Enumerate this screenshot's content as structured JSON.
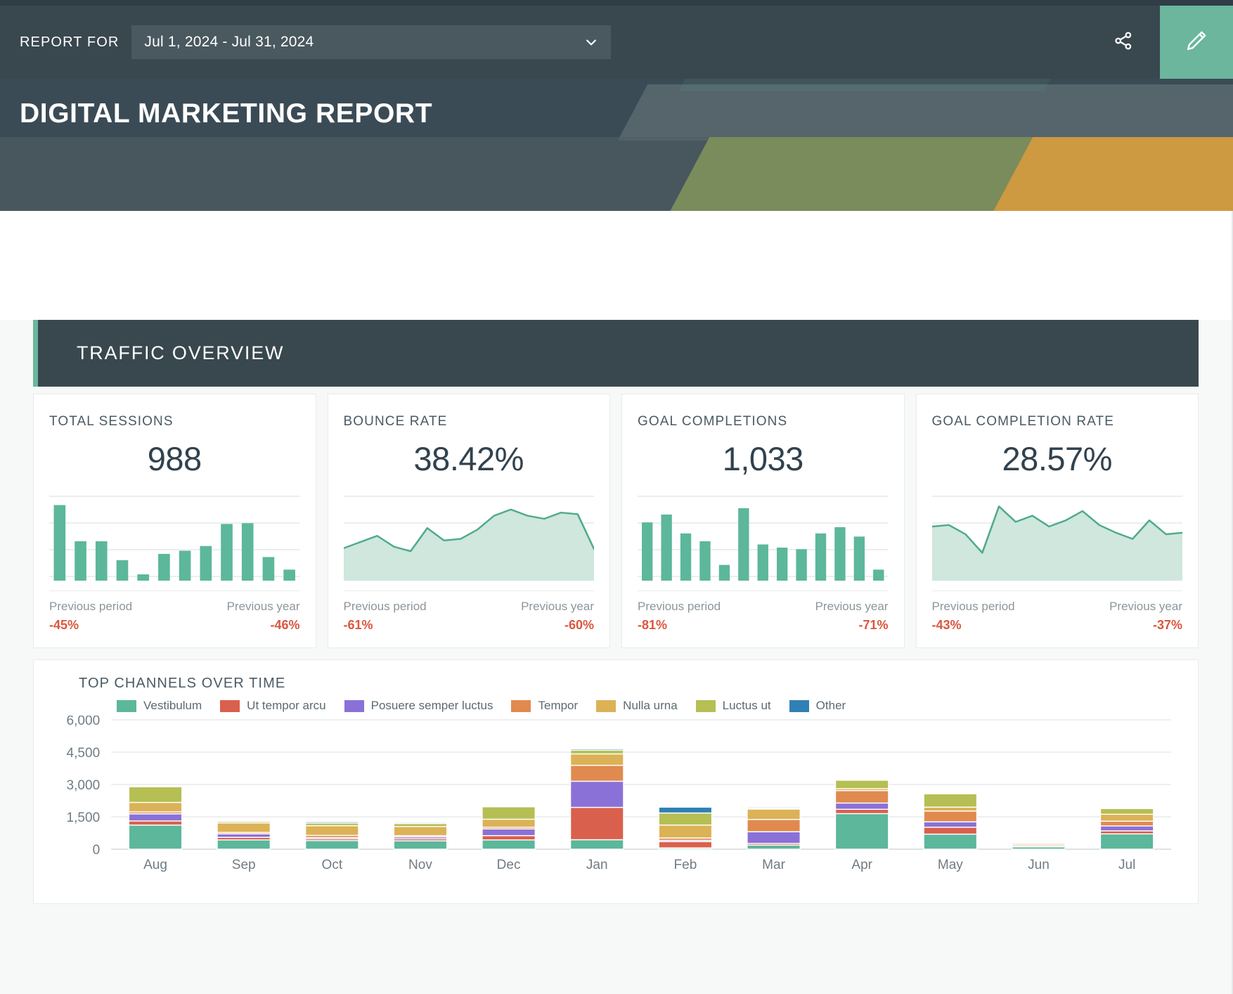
{
  "toolbar": {
    "report_for_label": "REPORT FOR",
    "date_range": "Jul 1, 2024 - Jul 31, 2024",
    "share_icon": "share-icon",
    "edit_icon": "pencil-icon",
    "chevron_icon": "chevron-down-icon"
  },
  "banner": {
    "title": "DIGITAL MARKETING REPORT",
    "bg": "#3b4b55",
    "accent": "#6bb69d"
  },
  "section": {
    "title": "TRAFFIC OVERVIEW",
    "accent_color": "#6bb69d",
    "bg": "#39474f"
  },
  "kpis": [
    {
      "label": "TOTAL SESSIONS",
      "value": "988",
      "spark_type": "bar",
      "spark_values": [
        96,
        50,
        50,
        26,
        8,
        34,
        38,
        44,
        72,
        73,
        30,
        14
      ],
      "prev_period_label": "Previous period",
      "prev_period_value": "-45%",
      "prev_year_label": "Previous year",
      "prev_year_value": "-46%"
    },
    {
      "label": "BOUNCE RATE",
      "value": "38.42%",
      "spark_type": "area",
      "spark_values": [
        42,
        50,
        58,
        44,
        38,
        68,
        52,
        54,
        66,
        84,
        92,
        84,
        80,
        88,
        86,
        40
      ],
      "prev_period_label": "Previous period",
      "prev_period_value": "-61%",
      "prev_year_label": "Previous year",
      "prev_year_value": "-60%"
    },
    {
      "label": "GOAL COMPLETIONS",
      "value": "1,033",
      "spark_type": "bar",
      "spark_values": [
        74,
        84,
        60,
        50,
        20,
        92,
        46,
        42,
        40,
        60,
        68,
        56,
        14
      ],
      "prev_period_label": "Previous period",
      "prev_period_value": "-81%",
      "prev_year_label": "Previous year",
      "prev_year_value": "-71%"
    },
    {
      "label": "GOAL COMPLETION RATE",
      "value": "28.57%",
      "spark_type": "area",
      "spark_values": [
        70,
        72,
        60,
        36,
        96,
        76,
        84,
        70,
        78,
        90,
        72,
        62,
        54,
        78,
        60,
        62
      ],
      "prev_period_label": "Previous period",
      "prev_period_value": "-43%",
      "prev_year_label": "Previous year",
      "prev_year_value": "-37%"
    }
  ],
  "chart_data": {
    "type": "bar",
    "stacked": true,
    "title": "TOP CHANNELS OVER TIME",
    "xlabel": "",
    "ylabel": "",
    "ylim": [
      0,
      6000
    ],
    "yticks": [
      0,
      1500,
      3000,
      4500,
      6000
    ],
    "ytick_labels": [
      "0",
      "1,500",
      "3,000",
      "4,500",
      "6,000"
    ],
    "grid": true,
    "legend_position": "top",
    "categories": [
      "Aug",
      "Sep",
      "Oct",
      "Nov",
      "Dec",
      "Jan",
      "Feb",
      "Mar",
      "Apr",
      "May",
      "Jun",
      "Jul"
    ],
    "series": [
      {
        "name": "Vestibulum",
        "color": "#5cb79b",
        "values": [
          1120,
          430,
          400,
          390,
          430,
          440,
          60,
          190,
          1650,
          700,
          110,
          710
        ]
      },
      {
        "name": "Ut tempor arcu",
        "color": "#d9604c",
        "values": [
          190,
          120,
          80,
          90,
          200,
          1500,
          290,
          80,
          200,
          320,
          30,
          140
        ]
      },
      {
        "name": "Posuere semper luctus",
        "color": "#8a71d8",
        "values": [
          330,
          160,
          60,
          90,
          310,
          1210,
          60,
          540,
          290,
          250,
          20,
          230
        ]
      },
      {
        "name": "Tempor",
        "color": "#e08a4f",
        "values": [
          90,
          70,
          100,
          60,
          80,
          740,
          110,
          570,
          580,
          500,
          60,
          220
        ]
      },
      {
        "name": "Nulla urna",
        "color": "#dcb256",
        "values": [
          440,
          440,
          450,
          420,
          370,
          530,
          600,
          480,
          90,
          180,
          60,
          320
        ]
      },
      {
        "name": "Luctus ut",
        "color": "#b5bf53",
        "values": [
          730,
          70,
          120,
          140,
          580,
          170,
          560,
          50,
          390,
          620,
          60,
          270
        ]
      },
      {
        "name": "Other",
        "color": "#3080b5",
        "values": [
          40,
          40,
          60,
          50,
          40,
          60,
          270,
          50,
          40,
          40,
          10,
          30
        ]
      }
    ]
  }
}
